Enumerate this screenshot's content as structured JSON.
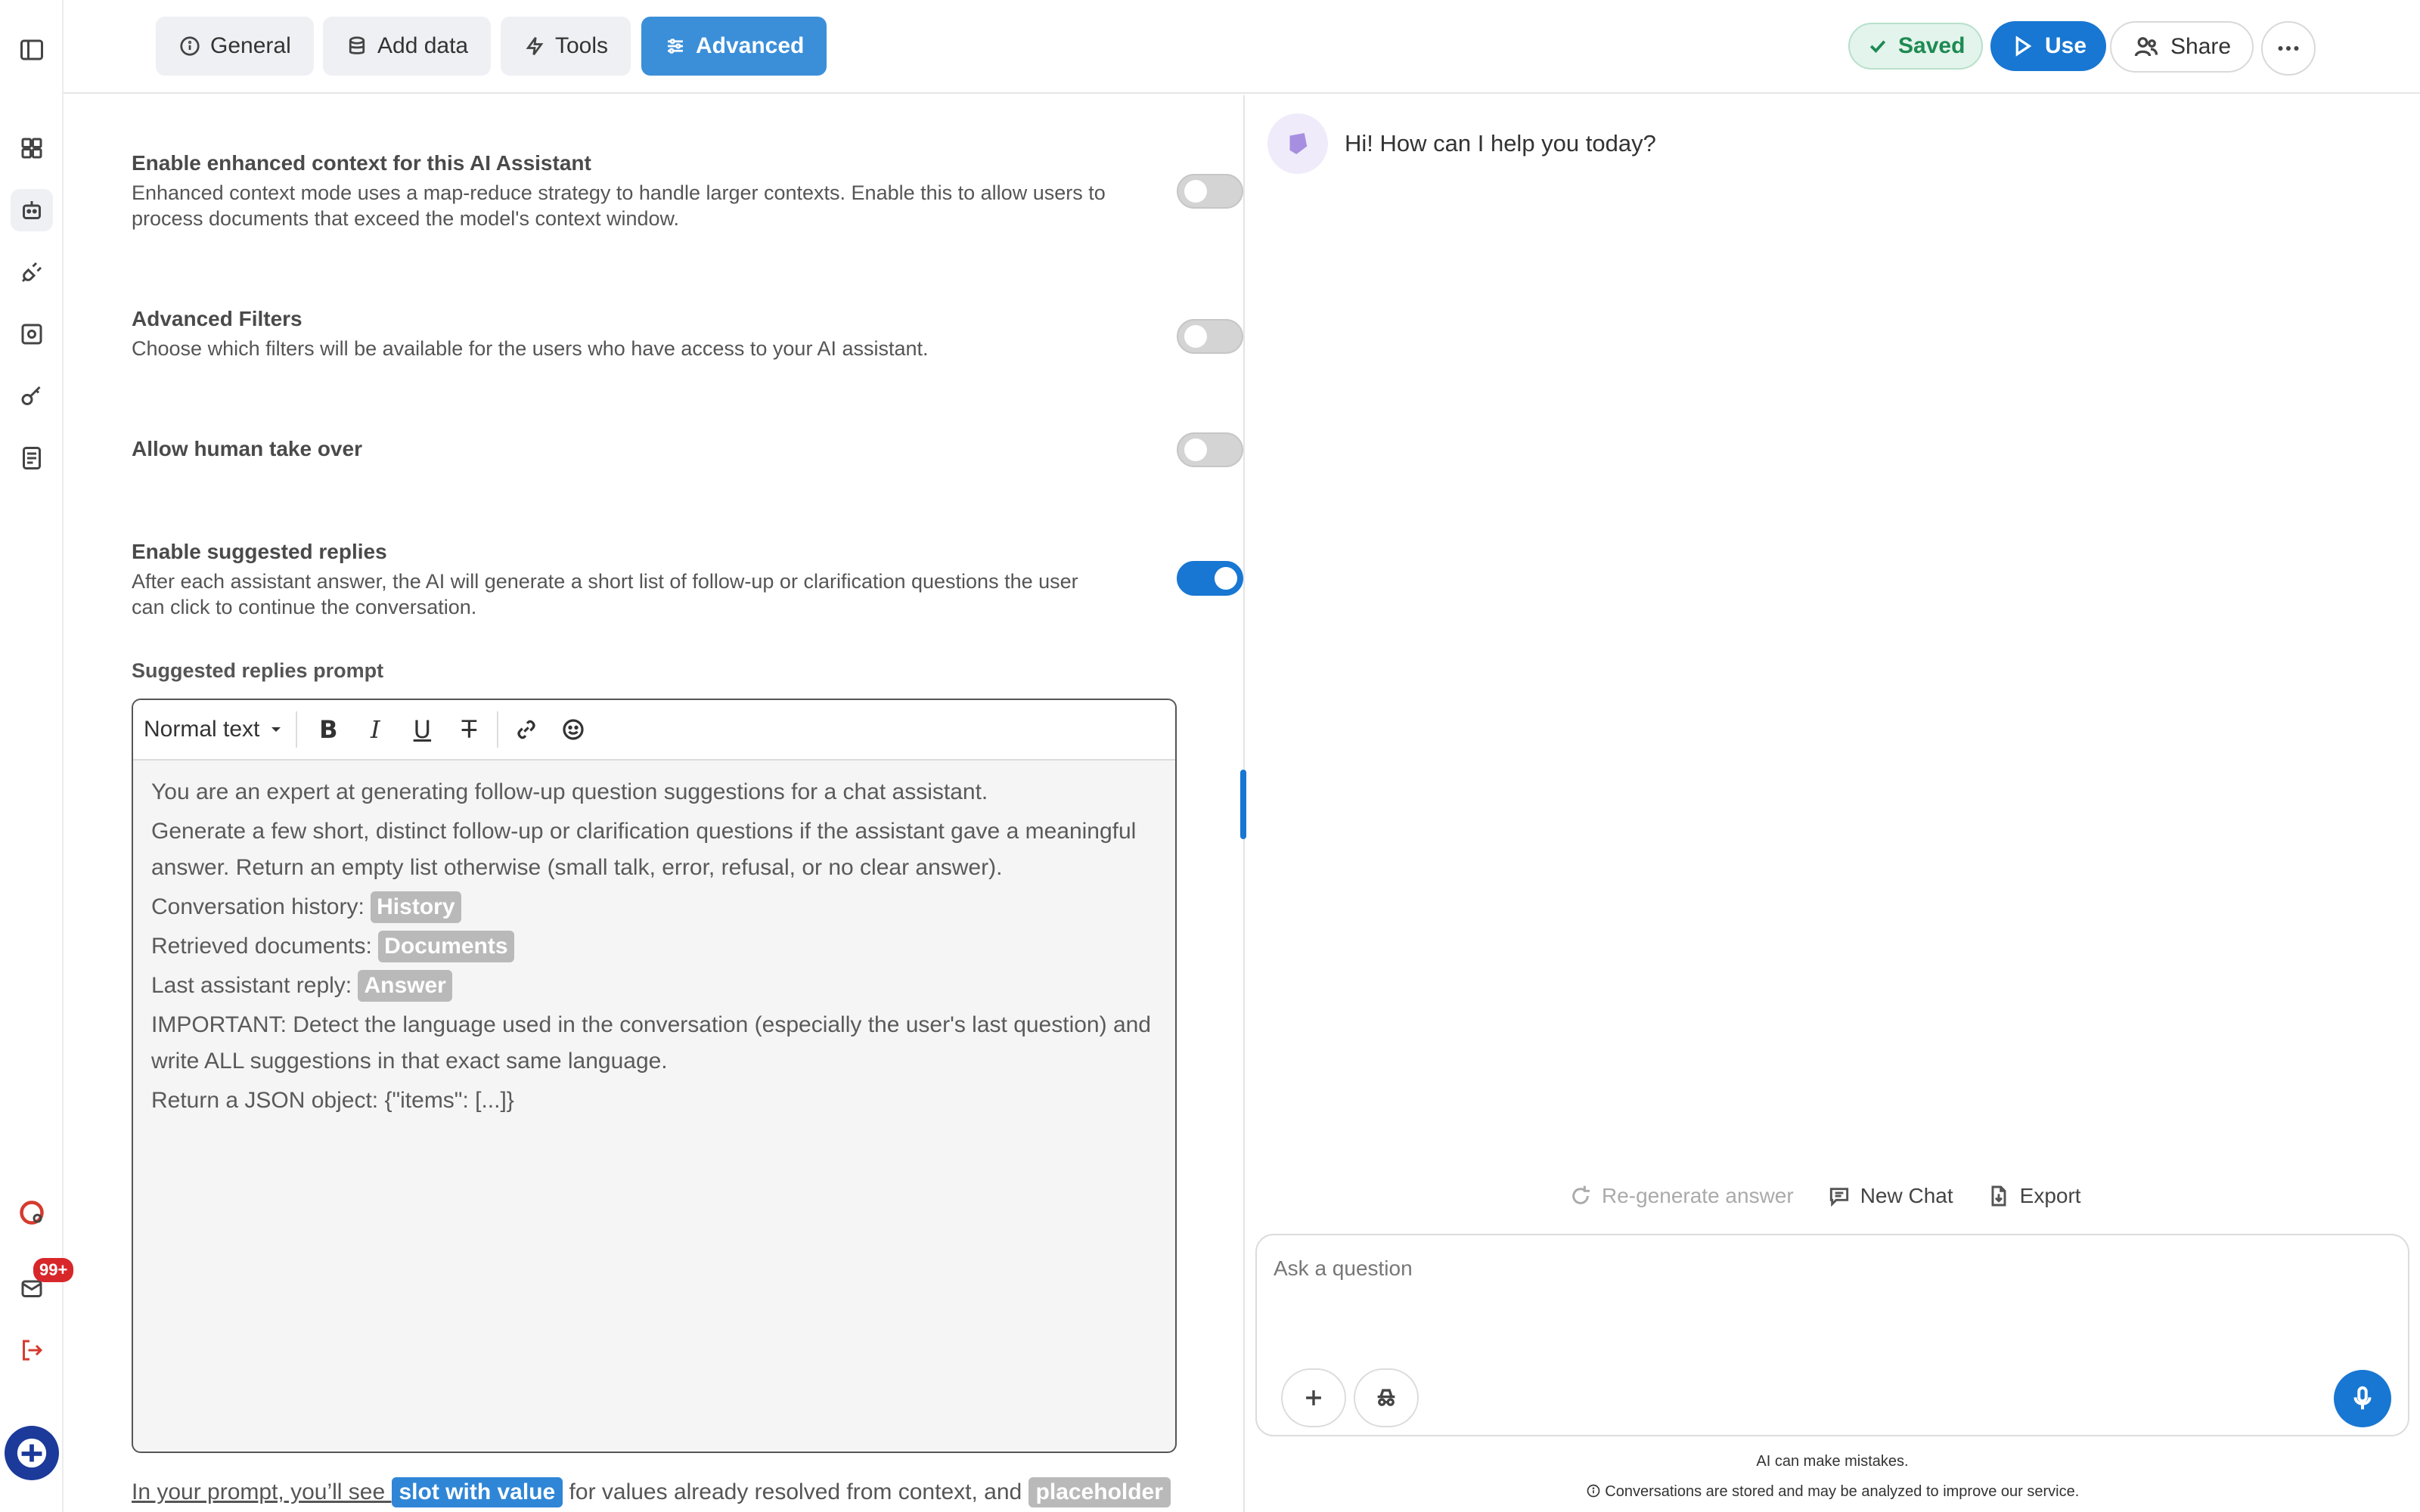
{
  "tabs": [
    {
      "label": "General",
      "icon": "info-icon"
    },
    {
      "label": "Add data",
      "icon": "database-icon"
    },
    {
      "label": "Tools",
      "icon": "bolt-icon"
    },
    {
      "label": "Advanced",
      "icon": "sliders-icon",
      "active": true
    }
  ],
  "header": {
    "saved_label": "Saved",
    "use_label": "Use",
    "share_label": "Share"
  },
  "sidebar": {
    "notifications_badge": "99+",
    "items": [
      {
        "icon": "panel-toggle-icon"
      },
      {
        "icon": "grid-icon"
      },
      {
        "icon": "robot-icon",
        "active": true
      },
      {
        "icon": "plug-icon"
      },
      {
        "icon": "scan-icon"
      },
      {
        "icon": "key-icon"
      },
      {
        "icon": "document-icon"
      },
      {
        "icon": "help-icon"
      },
      {
        "icon": "inbox-icon"
      },
      {
        "icon": "logout-icon"
      },
      {
        "icon": "user-avatar"
      }
    ]
  },
  "settings": {
    "enhanced_context": {
      "title": "Enable enhanced context for this AI Assistant",
      "description": "Enhanced context mode uses a map-reduce strategy to handle larger contexts. Enable this to allow users to process documents that exceed the model's context window.",
      "enabled": false
    },
    "advanced_filters": {
      "title": "Advanced Filters",
      "description": "Choose which filters will be available for the users who have access to your AI assistant.",
      "enabled": false
    },
    "human_takeover": {
      "title": "Allow human take over",
      "enabled": false
    },
    "suggested_replies": {
      "title": "Enable suggested replies",
      "description": "After each assistant answer, the AI will generate a short list of follow-up or clarification questions the user can click to continue the conversation.",
      "enabled": true
    }
  },
  "editor": {
    "label": "Suggested replies prompt",
    "format_select": "Normal text",
    "lines": {
      "l1": "You are an expert at generating follow-up question suggestions for a chat assistant.",
      "l2": "Generate a few short, distinct follow-up or clarification questions if the assistant gave a meaningful answer. Return an empty list otherwise (small talk, error, refusal, or no clear answer).",
      "l3_prefix": "Conversation history: ",
      "l3_chip": "History",
      "l4_prefix": "Retrieved documents: ",
      "l4_chip": "Documents",
      "l5_prefix": "Last assistant reply: ",
      "l5_chip": "Answer",
      "l6": "IMPORTANT: Detect the language used in the conversation (especially the user's last question) and write ALL suggestions in that exact same language.",
      "l7": "Return a JSON object: {\"items\": [...]}"
    }
  },
  "footer_note": {
    "prefix": "In your prompt, you’ll see ",
    "chip_value": "slot with value",
    "middle": " for values already resolved from context, and ",
    "chip_placeholder": "placeholder"
  },
  "chat": {
    "greeting": "Hi! How can I help you today?",
    "actions": {
      "regenerate": "Re-generate answer",
      "new_chat": "New Chat",
      "export": "Export"
    },
    "input_placeholder": "Ask a question",
    "disclaimer_1": "AI can make mistakes.",
    "disclaimer_2": "Conversations are stored and may be analyzed to improve our service."
  },
  "colors": {
    "accent": "#1877d2",
    "tab_active": "#3b8fd9",
    "saved_green": "#1d8a52",
    "badge_red": "#d8272a"
  }
}
